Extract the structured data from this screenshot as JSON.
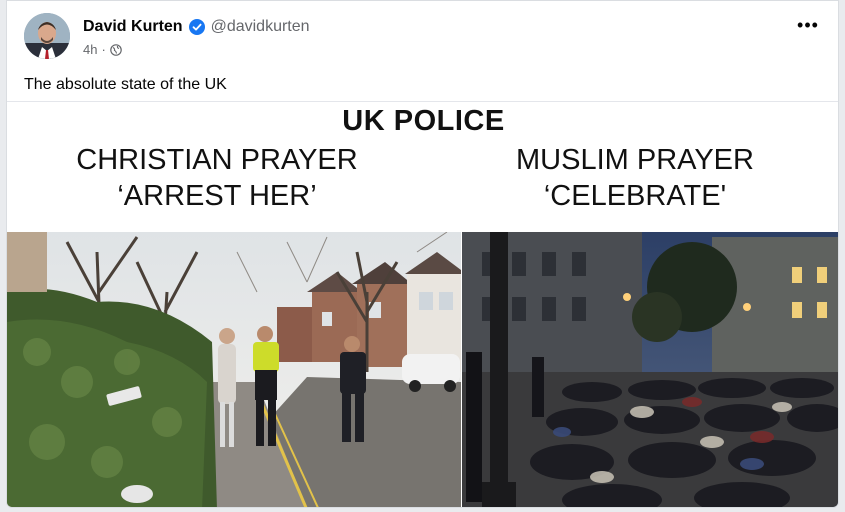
{
  "post": {
    "author": "David Kurten",
    "handle": "@davidkurten",
    "time": "4h",
    "separator": "·",
    "more_label": "•••",
    "text": "The absolute state of the UK"
  },
  "meme": {
    "title": "UK POLICE",
    "left_label_line1": "CHRISTIAN PRAYER",
    "left_label_line2": "‘ARREST HER’",
    "right_label_line1": "MUSLIM PRAYER",
    "right_label_line2": "‘CELEBRATE'"
  },
  "icons": {
    "verified": "verified-badge-icon",
    "audience": "globe-icon",
    "more": "more-options-icon"
  },
  "colors": {
    "verified": "#1877f2",
    "text_primary": "#050505",
    "text_secondary": "#65676b"
  }
}
